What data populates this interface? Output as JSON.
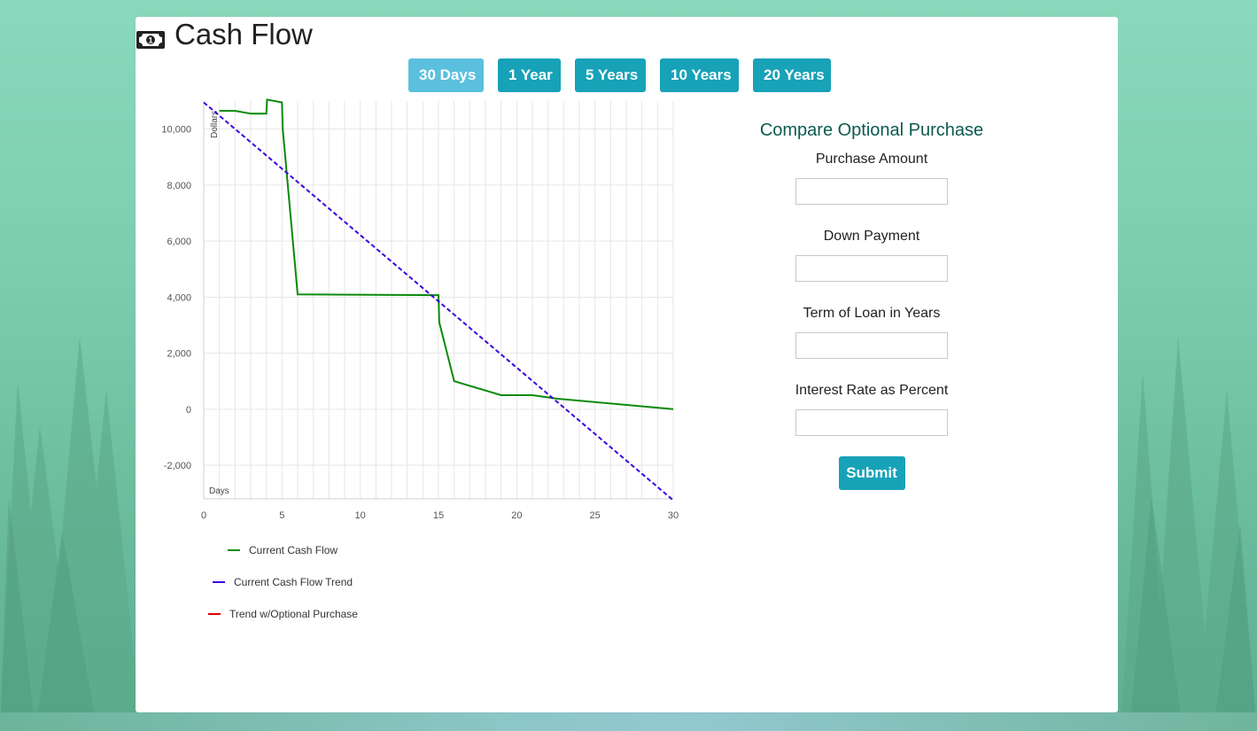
{
  "page": {
    "title": "Cash Flow",
    "title_icon": "money-bill-icon"
  },
  "range_buttons": [
    {
      "label": "30 Days",
      "active": true
    },
    {
      "label": "1 Year",
      "active": false
    },
    {
      "label": "5 Years",
      "active": false
    },
    {
      "label": "10 Years",
      "active": false
    },
    {
      "label": "20 Years",
      "active": false
    }
  ],
  "chart_data": {
    "type": "line",
    "xlabel": "Days",
    "ylabel": "Dollars",
    "xlim": [
      0,
      30
    ],
    "ylim": [
      -3200,
      11000
    ],
    "x_ticks": [
      0,
      5,
      10,
      15,
      20,
      25,
      30
    ],
    "x_tick_labels": [
      "0",
      "5",
      "10",
      "15",
      "20",
      "25",
      "30"
    ],
    "y_ticks": [
      -2000,
      0,
      2000,
      4000,
      6000,
      8000,
      10000
    ],
    "y_tick_labels": [
      "-2,000",
      "0",
      "2,000",
      "4,000",
      "6,000",
      "8,000",
      "10,000"
    ],
    "grid": true,
    "legend_position": "bottom-left",
    "series": [
      {
        "name": "Current Cash Flow",
        "color": "#0a8a0a",
        "style": "solid",
        "points": [
          [
            1,
            10650
          ],
          [
            2,
            10650
          ],
          [
            3,
            10550
          ],
          [
            4,
            10550
          ],
          [
            4.05,
            11050
          ],
          [
            5,
            10950
          ],
          [
            5.05,
            10000
          ],
          [
            6,
            4100
          ],
          [
            15,
            4070
          ],
          [
            15.05,
            3100
          ],
          [
            16,
            1000
          ],
          [
            19,
            500
          ],
          [
            21,
            500
          ],
          [
            22.5,
            380
          ],
          [
            30,
            0
          ]
        ]
      },
      {
        "name": "Current Cash Flow Trend",
        "color": "#3a00e0",
        "style": "dashed",
        "points": [
          [
            0,
            10950
          ],
          [
            30,
            -3250
          ]
        ]
      },
      {
        "name": "Trend w/Optional Purchase",
        "color": "#e00000",
        "style": "solid",
        "points": []
      }
    ]
  },
  "form": {
    "title": "Compare Optional Purchase",
    "fields": [
      {
        "label": "Purchase Amount",
        "value": ""
      },
      {
        "label": "Down Payment",
        "value": ""
      },
      {
        "label": "Term of Loan in Years",
        "value": ""
      },
      {
        "label": "Interest Rate as Percent",
        "value": ""
      }
    ],
    "submit_label": "Submit"
  },
  "colors": {
    "accent": "#17a2b8",
    "accent_active": "#5bc0de",
    "form_title": "#0b5a4d"
  }
}
